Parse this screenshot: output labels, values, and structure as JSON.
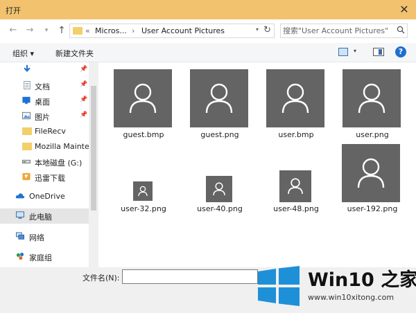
{
  "window": {
    "title": "打开",
    "close_glyph": "✕"
  },
  "nav": {
    "back_glyph": "←",
    "forward_glyph": "→",
    "recent_glyph": "▾",
    "up_glyph": "↑",
    "breadcrumb_prefix": "«",
    "breadcrumb": [
      "Micros...",
      "User Account Pictures"
    ],
    "separator": "›",
    "refresh_glyph": "↻",
    "search_placeholder": "搜索\"User Account Pictures\"",
    "search_icon": "search-icon"
  },
  "toolbar": {
    "organize": "组织 ▾",
    "new_folder": "新建文件夹",
    "view_dropdown": "▾",
    "help": "?"
  },
  "sidebar": {
    "items": [
      {
        "label": "",
        "icon": "download-arrow-icon",
        "pinned": true
      },
      {
        "label": "文档",
        "icon": "documents-icon",
        "pinned": true
      },
      {
        "label": "桌面",
        "icon": "desktop-icon",
        "pinned": true
      },
      {
        "label": "图片",
        "icon": "pictures-icon",
        "pinned": true
      },
      {
        "label": "FileRecv",
        "icon": "folder-icon",
        "pinned": false
      },
      {
        "label": "Mozilla Mainte",
        "icon": "folder-icon",
        "pinned": false
      },
      {
        "label": "本地磁盘 (G:)",
        "icon": "drive-icon",
        "pinned": false
      },
      {
        "label": "迅雷下载",
        "icon": "download-folder-icon",
        "pinned": false
      },
      {
        "label": "OneDrive",
        "icon": "cloud-icon",
        "pinned": false
      },
      {
        "label": "此电脑",
        "icon": "computer-icon",
        "pinned": false,
        "selected": true
      },
      {
        "label": "网络",
        "icon": "network-icon",
        "pinned": false
      },
      {
        "label": "家庭组",
        "icon": "homegroup-icon",
        "pinned": false
      }
    ],
    "pin_glyph": "📌"
  },
  "files": [
    {
      "name": "guest.bmp"
    },
    {
      "name": "guest.png"
    },
    {
      "name": "user.bmp"
    },
    {
      "name": "user.png"
    },
    {
      "name": "user-32.png"
    },
    {
      "name": "user-40.png"
    },
    {
      "name": "user-48.png"
    },
    {
      "name": "user-192.png"
    }
  ],
  "bottom": {
    "filename_label": "文件名(N):",
    "filename_value": ""
  },
  "watermark": {
    "brand": "Win10 之家",
    "url": "www.win10xitong.com"
  },
  "colors": {
    "titlebar": "#f2c26e",
    "thumb": "#646464",
    "accent": "#1e6fd0",
    "logo_blue": "#1e90d8"
  }
}
